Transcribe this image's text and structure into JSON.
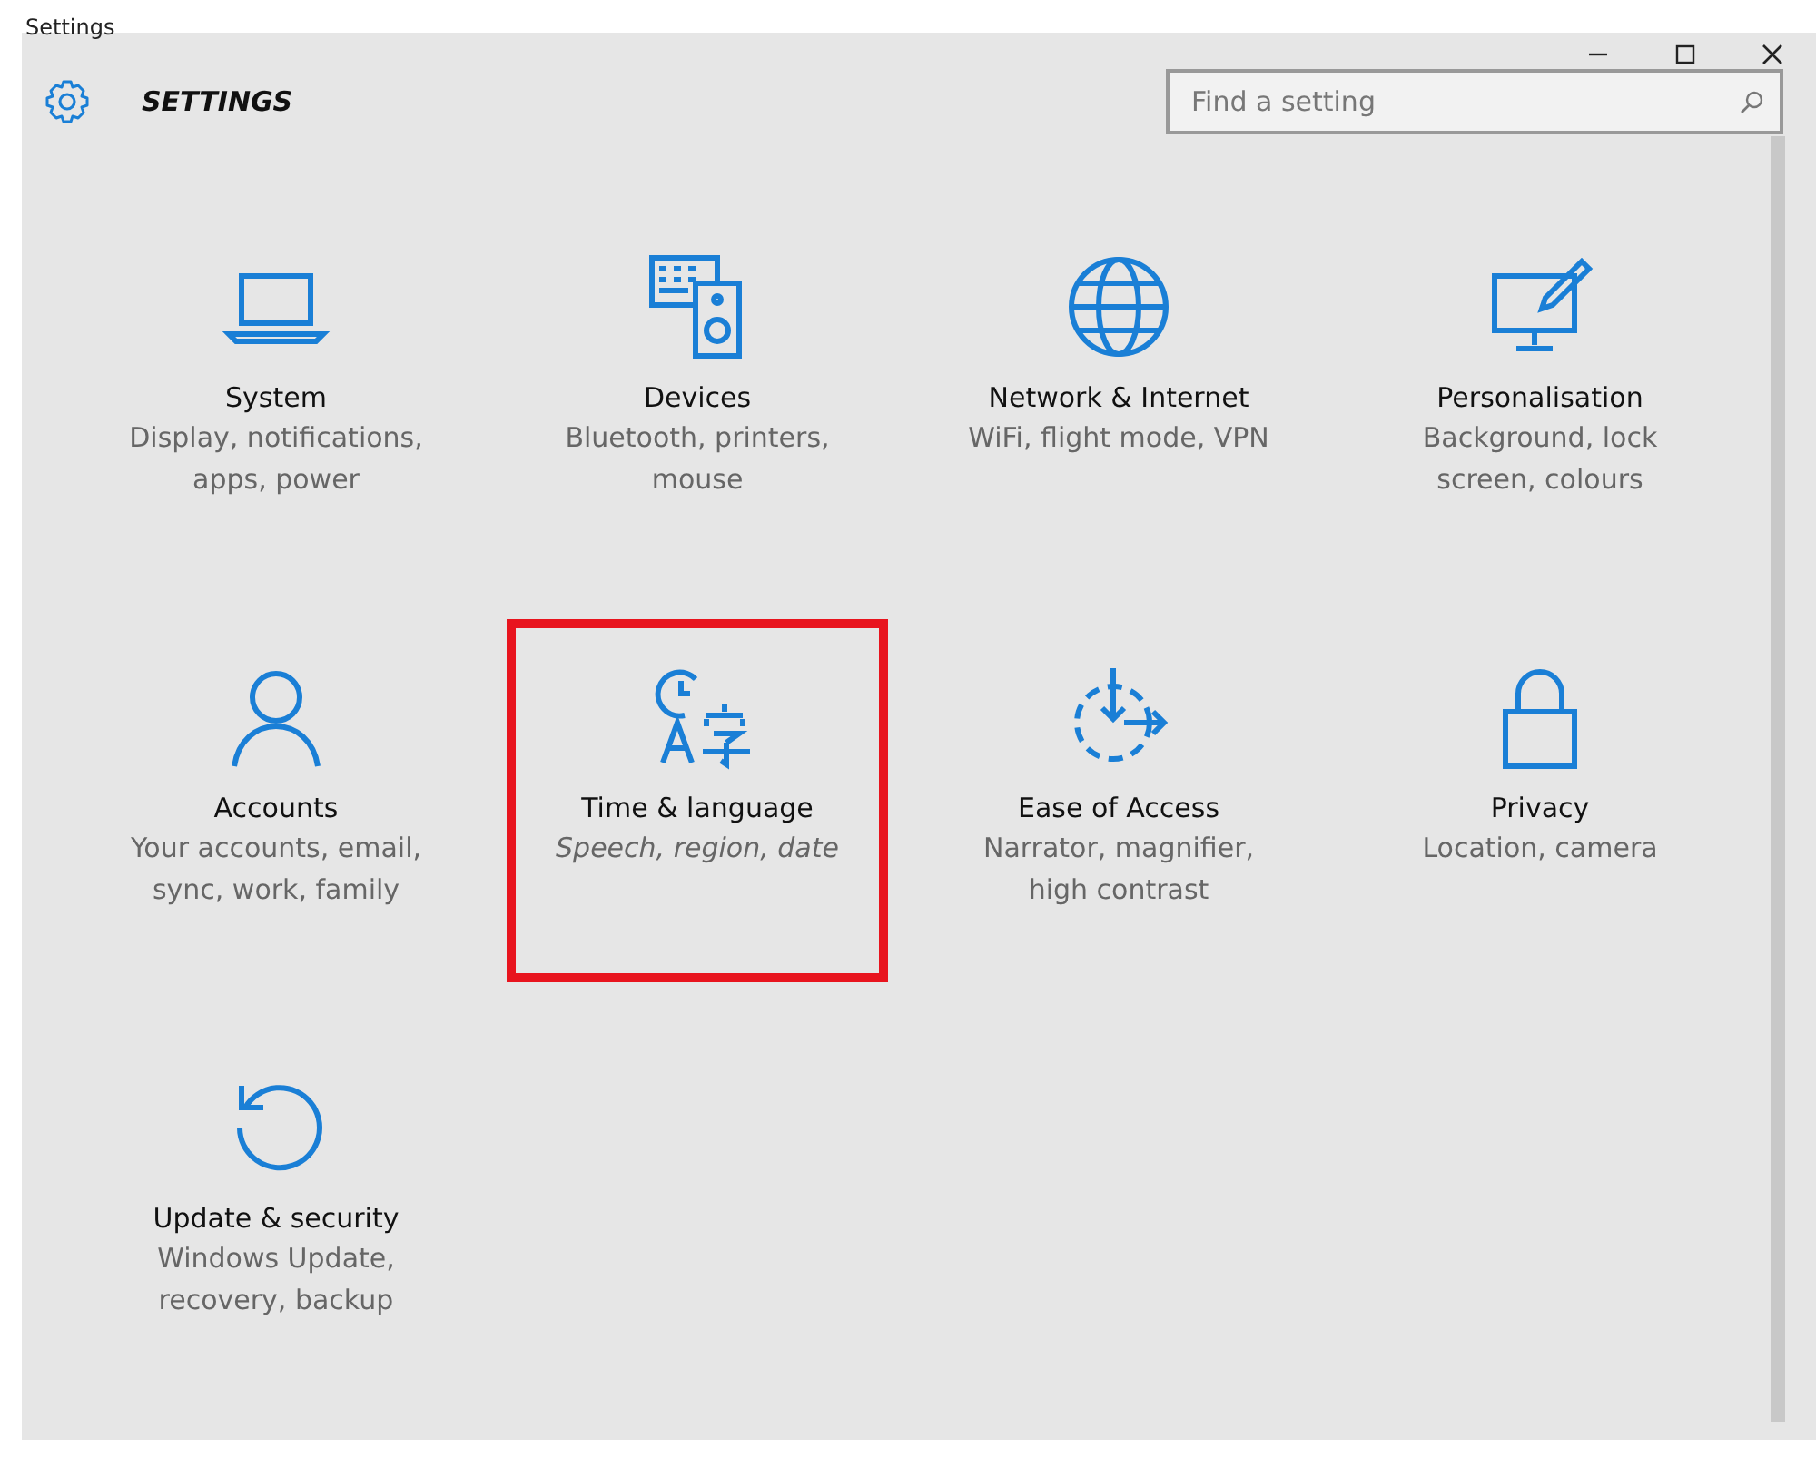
{
  "window": {
    "title": "Settings"
  },
  "header": {
    "title": "SETTINGS"
  },
  "search": {
    "placeholder": "Find a setting"
  },
  "categories": [
    {
      "kind": "laptop",
      "title": "System",
      "subtitle": "Display, notifications, apps, power",
      "highlighted": false
    },
    {
      "kind": "devices",
      "title": "Devices",
      "subtitle": "Bluetooth, printers, mouse",
      "highlighted": false
    },
    {
      "kind": "globe",
      "title": "Network & Internet",
      "subtitle": "WiFi, flight mode, VPN",
      "highlighted": false
    },
    {
      "kind": "paint",
      "title": "Personalisation",
      "subtitle": "Background, lock screen, colours",
      "highlighted": false
    },
    {
      "kind": "person",
      "title": "Accounts",
      "subtitle": "Your accounts, email, sync, work, family",
      "highlighted": false
    },
    {
      "kind": "timelang",
      "title": "Time & language",
      "subtitle": "Speech, region, date",
      "highlighted": true
    },
    {
      "kind": "ease",
      "title": "Ease of Access",
      "subtitle": "Narrator, magnifier, high contrast",
      "highlighted": false
    },
    {
      "kind": "lock",
      "title": "Privacy",
      "subtitle": "Location, camera",
      "highlighted": false
    },
    {
      "kind": "update",
      "title": "Update & security",
      "subtitle": "Windows Update, recovery, backup",
      "highlighted": false
    }
  ]
}
